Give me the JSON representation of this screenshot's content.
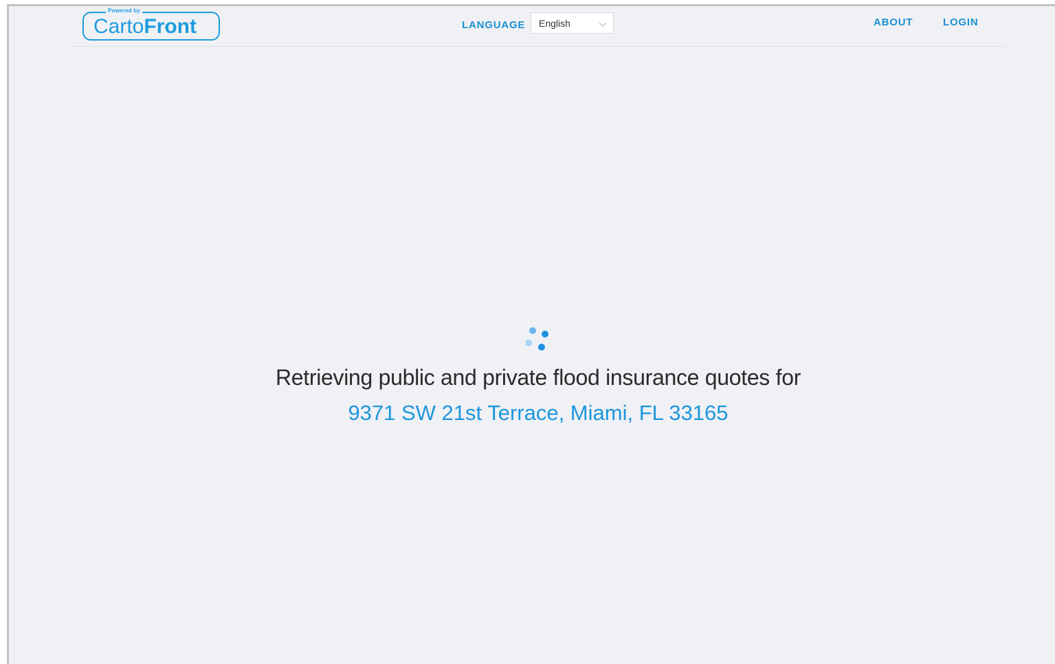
{
  "header": {
    "logo": {
      "powered_by": "Powered by",
      "brand_light": "Carto",
      "brand_bold": "Front"
    },
    "language_label": "LANGUAGE",
    "language_selected": "English",
    "nav": {
      "about": "ABOUT",
      "login": "LOGIN"
    }
  },
  "main": {
    "status_text": "Retrieving public and private flood insurance quotes for",
    "address": "9371 SW 21st Terrace, Miami, FL 33165"
  },
  "colors": {
    "accent": "#1e96dc",
    "background": "#eff1f5",
    "text": "#2a2a2a"
  },
  "icons": [
    "chevron-down-icon",
    "loading-spinner-icon"
  ]
}
